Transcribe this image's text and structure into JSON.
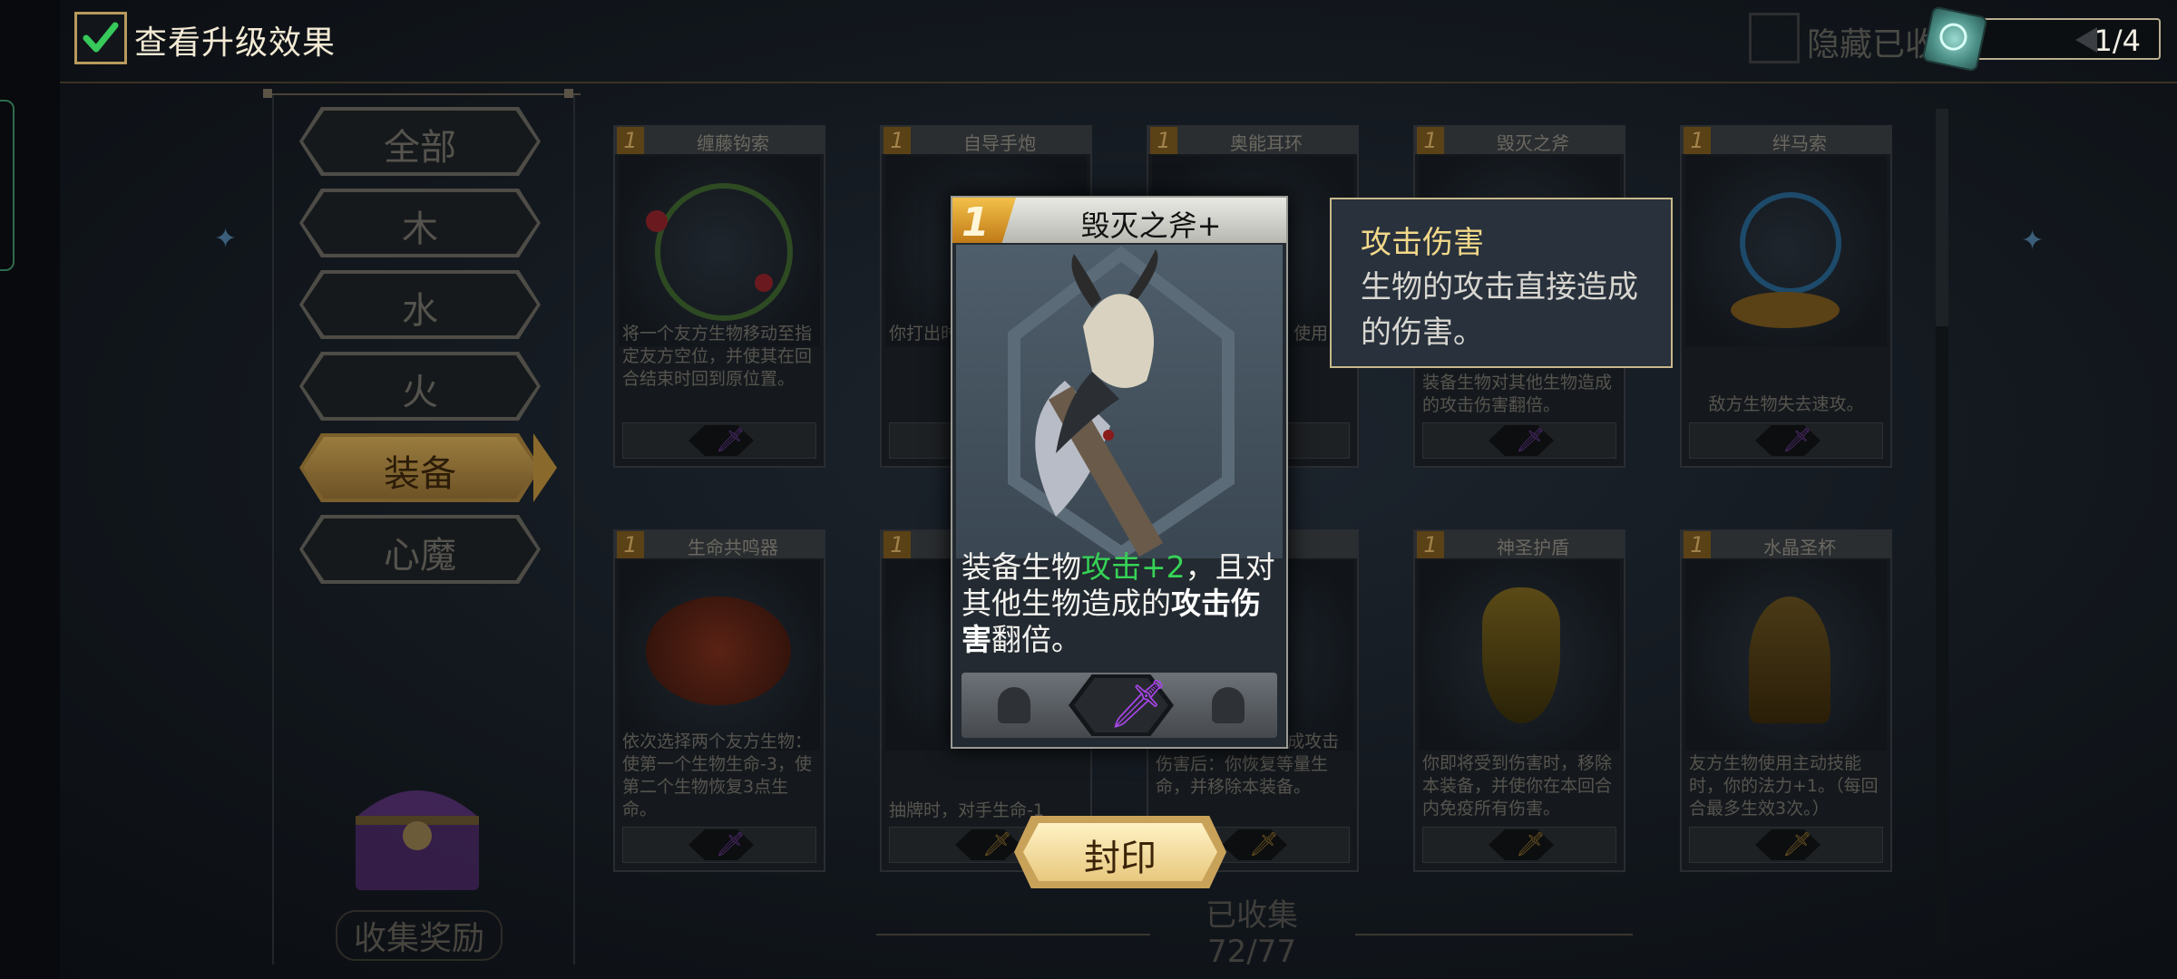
{
  "header": {
    "show_upgrade_label": "查看升级效果",
    "show_upgrade_checked": true,
    "hide_collected_label": "隐藏已收",
    "page_indicator": "1/4"
  },
  "filters": [
    {
      "label": "全部",
      "active": false
    },
    {
      "label": "木",
      "active": false
    },
    {
      "label": "水",
      "active": false
    },
    {
      "label": "火",
      "active": false
    },
    {
      "label": "装备",
      "active": true
    },
    {
      "label": "心魔",
      "active": false
    }
  ],
  "collection_reward_label": "收集奖励",
  "cards": [
    {
      "level": "1",
      "name": "缠藤钩索",
      "desc": "将一个友方生物移动至指定友方空位，并使其在回合结束时回到原位置。",
      "slot_icon": "dagger"
    },
    {
      "level": "1",
      "name": "自导手炮",
      "desc": "你打出时，使物的生",
      "slot_icon": "dagger"
    },
    {
      "level": "1",
      "name": "奥能耳环",
      "desc": "使用1",
      "slot_icon": "helmet"
    },
    {
      "level": "1",
      "name": "毁灭之斧",
      "desc": "装备生物对其他生物造成的攻击伤害翻倍。",
      "slot_icon": "dagger"
    },
    {
      "level": "1",
      "name": "绊马索",
      "desc": "敌方生物失去速攻。",
      "slot_icon": "dagger"
    },
    {
      "level": "1",
      "name": "生命共鸣器",
      "desc": "依次选择两个友方生物：使第一个生物生命-3，使第二个生物恢复3点生命。",
      "slot_icon": "dagger"
    },
    {
      "level": "1",
      "name": "",
      "desc": "抽牌时，对手生命-1",
      "slot_icon": "gold"
    },
    {
      "level": "1",
      "name": "",
      "desc": "2，给敌方生物造成攻击伤害后：你恢复等量生命，并移除本装备。",
      "slot_icon": "gold"
    },
    {
      "level": "1",
      "name": "神圣护盾",
      "desc": "你即将受到伤害时，移除本装备，并使你在本回合内免疫所有伤害。",
      "slot_icon": "gold"
    },
    {
      "level": "1",
      "name": "水晶圣杯",
      "desc": "友方生物使用主动技能时，你的法力+1。（每回合最多生效3次。）",
      "slot_icon": "gold"
    }
  ],
  "detail": {
    "level": "1",
    "name": "毁灭之斧+",
    "text_part1": "装备生物",
    "text_green": "攻击+2",
    "text_part2": "，且对其他生物造成的",
    "text_bold": "攻击伤害",
    "text_part3": "翻倍。"
  },
  "tooltip": {
    "title": "攻击伤害",
    "body": "生物的攻击直接造成的伤害。"
  },
  "seal_button_label": "封印",
  "collected": {
    "label": "已收集",
    "count": "72/77"
  },
  "colors": {
    "accent_gold": "#c9a25a",
    "highlight_green": "#36d356",
    "dagger_purple": "#a945e8",
    "check_green": "#37c95a"
  }
}
